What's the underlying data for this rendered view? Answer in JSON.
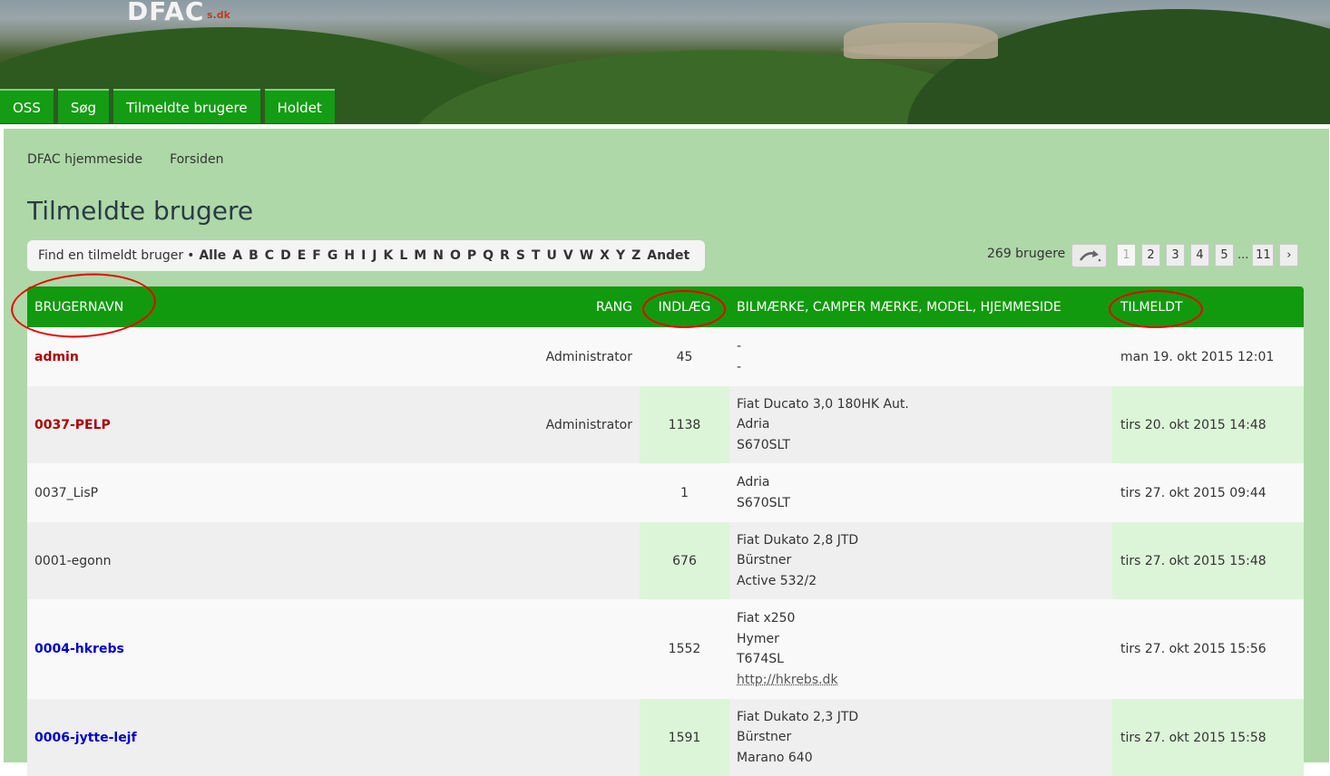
{
  "header": {
    "logo": "DFAC",
    "logo_sub": "s.dk",
    "nav": [
      "OSS",
      "Søg",
      "Tilmeldte brugere",
      "Holdet"
    ]
  },
  "breadcrumb": [
    "DFAC hjemmeside",
    "Forsiden"
  ],
  "page_title": "Tilmeldte brugere",
  "finder": {
    "label": "Find en tilmeldt bruger",
    "bullet": "•",
    "letters": [
      "Alle",
      "A",
      "B",
      "C",
      "D",
      "E",
      "F",
      "G",
      "H",
      "I",
      "J",
      "K",
      "L",
      "M",
      "N",
      "O",
      "P",
      "Q",
      "R",
      "S",
      "T",
      "U",
      "V",
      "W",
      "X",
      "Y",
      "Z",
      "Andet"
    ]
  },
  "user_count": "269 brugere",
  "pagination": {
    "pages": [
      "1",
      "2",
      "3",
      "4",
      "5"
    ],
    "ellipsis": "...",
    "last": "11",
    "next": "›"
  },
  "table": {
    "headers": {
      "name": "BRUGERNAVN",
      "rank": "RANG",
      "posts": "INDLÆG",
      "vehicle": "BILMÆRKE, CAMPER MÆRKE, MODEL, HJEMMESIDE",
      "joined": "TILMELDT"
    },
    "rows": [
      {
        "name": "admin",
        "style": "admin",
        "rank": "Administrator",
        "posts": "45",
        "vehicle": [
          "-",
          "-"
        ],
        "joined": "man 19. okt 2015 12:01"
      },
      {
        "name": "0037-PELP",
        "style": "admin",
        "rank": "Administrator",
        "posts": "1138",
        "vehicle": [
          "Fiat Ducato 3,0 180HK Aut.",
          "Adria",
          "S670SLT"
        ],
        "joined": "tirs 20. okt 2015 14:48"
      },
      {
        "name": "0037_LisP",
        "style": "plain",
        "rank": "",
        "posts": "1",
        "vehicle": [
          "Adria",
          "S670SLT"
        ],
        "joined": "tirs 27. okt 2015 09:44"
      },
      {
        "name": "0001-egonn",
        "style": "plain",
        "rank": "",
        "posts": "676",
        "vehicle": [
          "Fiat Dukato 2,8 JTD",
          "Bürstner",
          "Active 532/2"
        ],
        "joined": "tirs 27. okt 2015 15:48"
      },
      {
        "name": "0004-hkrebs",
        "style": "mod",
        "rank": "",
        "posts": "1552",
        "vehicle": [
          "Fiat x250",
          "Hymer",
          "T674SL"
        ],
        "link": "http://hkrebs.dk",
        "joined": "tirs 27. okt 2015 15:56"
      },
      {
        "name": "0006-jytte-lejf",
        "style": "mod",
        "rank": "",
        "posts": "1591",
        "vehicle": [
          "Fiat Dukato 2,3 JTD",
          "Bürstner",
          "Marano 640"
        ],
        "joined": "tirs 27. okt 2015 15:58"
      }
    ]
  },
  "colors": {
    "header_green": "#119a0d",
    "page_bg": "#aed8a8",
    "admin_red": "#aa0000",
    "mod_blue": "#0000cc",
    "annotation_red": "#e00000"
  }
}
